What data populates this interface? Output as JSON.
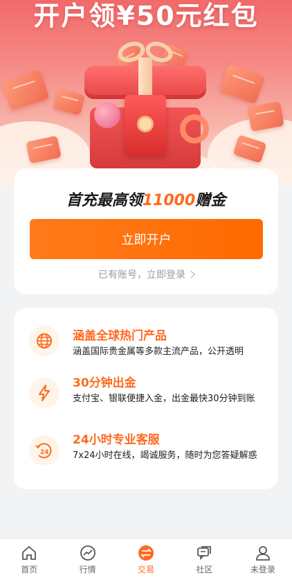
{
  "hero": {
    "title": "开户领¥50元红包"
  },
  "signup": {
    "headline_prefix": "首充最高领",
    "headline_amount": "11000",
    "headline_suffix": "赠金",
    "open_button": "立即开户",
    "login_text": "已有账号，立即登录"
  },
  "features": [
    {
      "icon": "globe-icon",
      "title": "涵盖全球热门产品",
      "desc": "涵盖国际贵金属等多款主流产品，公开透明"
    },
    {
      "icon": "lightning-icon",
      "title": "30分钟出金",
      "desc": "支付宝、银联便捷入金，出金最快30分钟到账"
    },
    {
      "icon": "24h-service-icon",
      "title": "24小时专业客服",
      "desc": "7x24小时在线，竭诚服务，随时为您答疑解惑"
    }
  ],
  "tabbar": {
    "items": [
      {
        "label": "首页",
        "icon": "home-icon"
      },
      {
        "label": "行情",
        "icon": "market-trend-icon"
      },
      {
        "label": "交易",
        "icon": "trade-exchange-icon"
      },
      {
        "label": "社区",
        "icon": "community-icon"
      },
      {
        "label": "未登录",
        "icon": "user-icon"
      }
    ],
    "active_index": 2
  },
  "colors": {
    "accent": "#ff6a1f",
    "button": "#ff7a1a",
    "hero_top": "#f26a6a"
  }
}
